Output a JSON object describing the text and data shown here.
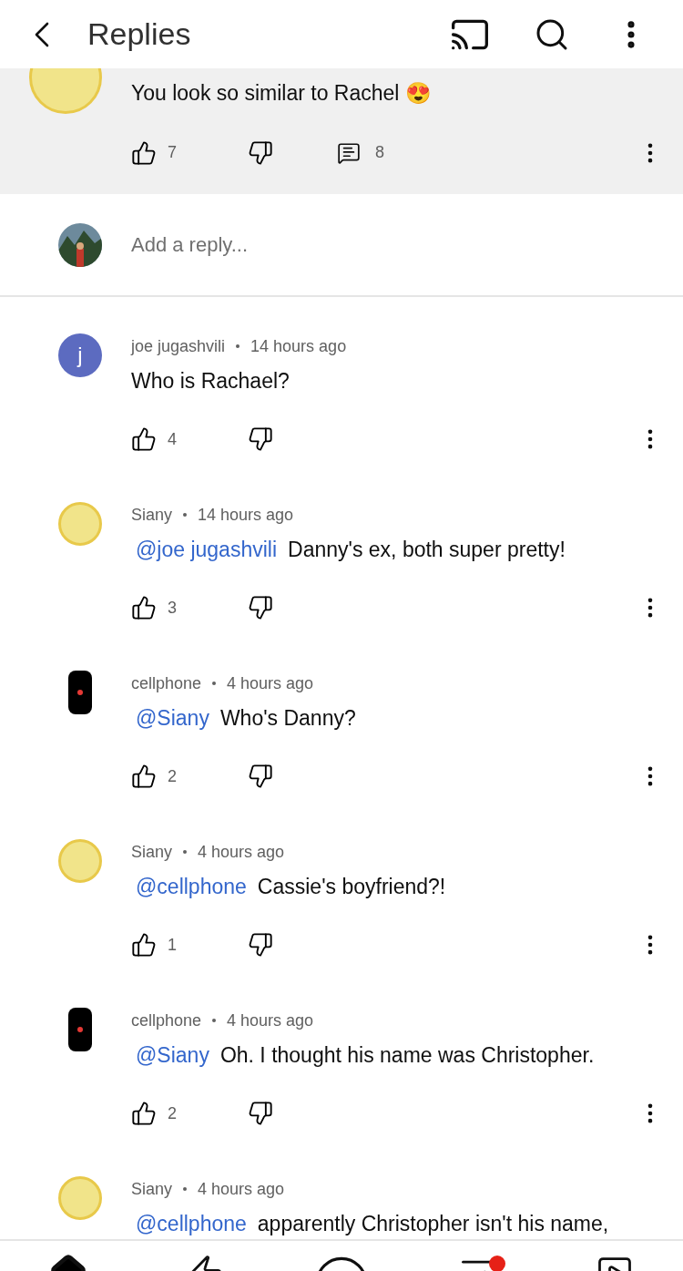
{
  "header": {
    "title": "Replies"
  },
  "pinned_comment": {
    "kind": "cartoon",
    "text": "You look so similar to Rachel 😍",
    "likes": "7",
    "replies": "8"
  },
  "reply_field": {
    "placeholder": "Add a reply..."
  },
  "comments": [
    {
      "kind": "letter",
      "letter": "j",
      "color": "#5c6bc0",
      "author": "joe jugashvili",
      "time": "14 hours ago",
      "text": "Who is Rachael?",
      "likes": "4"
    },
    {
      "kind": "cartoon",
      "author": "Siany",
      "time": "14 hours ago",
      "mention": "@joe jugashvili",
      "text": "Danny's ex, both super pretty!",
      "likes": "3"
    },
    {
      "kind": "phone",
      "author": "cellphone",
      "time": "4 hours ago",
      "mention": "@Siany",
      "text": "Who's Danny?",
      "likes": "2"
    },
    {
      "kind": "cartoon",
      "author": "Siany",
      "time": "4 hours ago",
      "mention": "@cellphone",
      "text": "Cassie's boyfriend?!",
      "likes": "1"
    },
    {
      "kind": "phone",
      "author": "cellphone",
      "time": "4 hours ago",
      "mention": "@Siany",
      "text": "Oh. I thought his name was Christopher.",
      "likes": "2"
    },
    {
      "kind": "cartoon",
      "author": "Siany",
      "time": "4 hours ago",
      "mention": "@cellphone",
      "text": "apparently Christopher isn't his name,"
    }
  ],
  "bottom_nav": [
    {
      "kind": "home",
      "selected": true,
      "badge": false
    },
    {
      "kind": "shorts",
      "selected": false,
      "badge": false
    },
    {
      "kind": "create",
      "selected": false,
      "badge": false
    },
    {
      "kind": "subscriptions",
      "selected": false,
      "badge": true
    },
    {
      "kind": "library",
      "selected": false,
      "badge": false
    }
  ]
}
